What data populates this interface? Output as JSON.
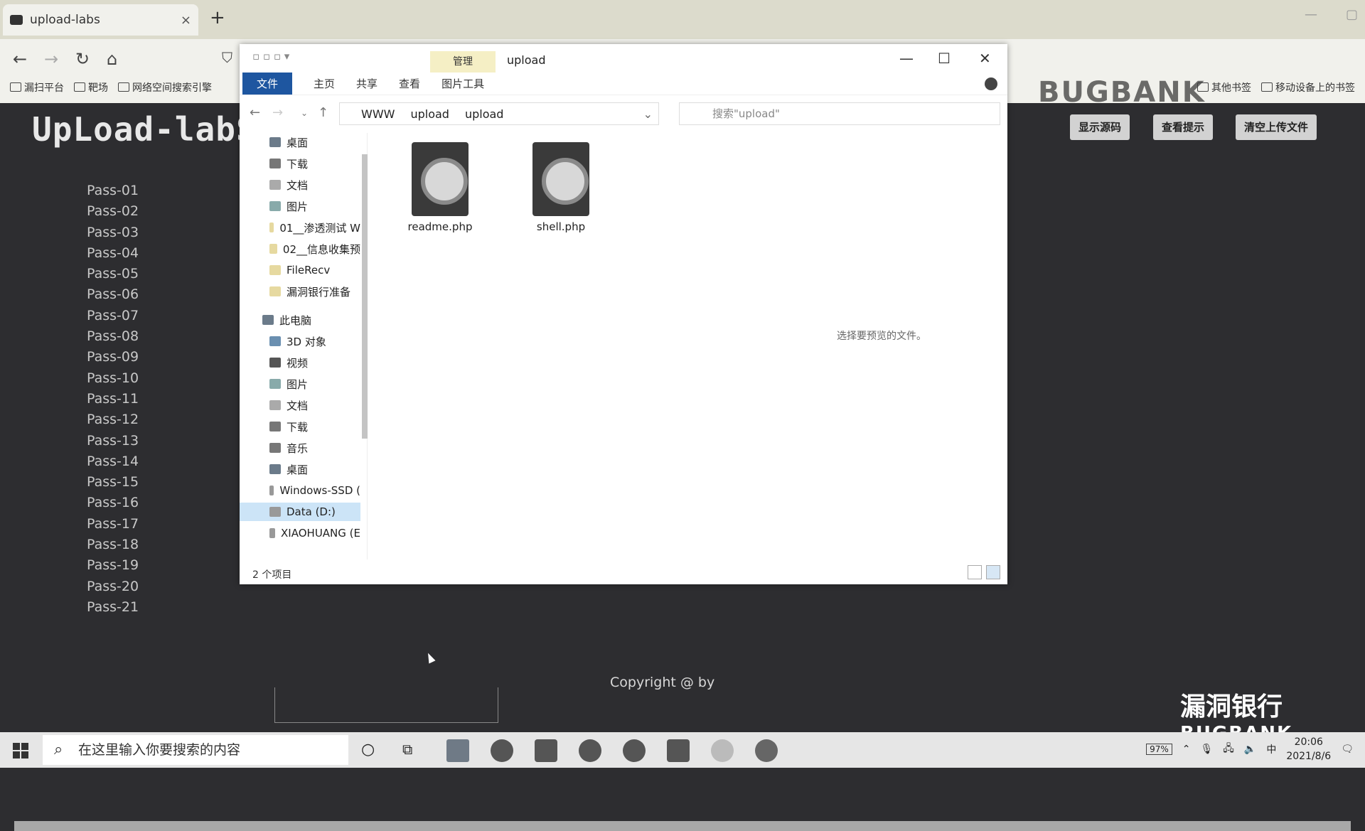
{
  "browser": {
    "tab_title": "upload-labs",
    "tab_close": "×",
    "new_tab": "+",
    "bookmarks": [
      "漏扫平台",
      "靶场",
      "网络空间搜索引擎"
    ],
    "bookmarks_right": [
      "其他书签",
      "移动设备上的书签"
    ],
    "watermark": "BUGBANK"
  },
  "page": {
    "logo": "UpLoad-labS",
    "buttons": [
      "显示源码",
      "查看提示",
      "清空上传文件"
    ],
    "pass_list": [
      "Pass-01",
      "Pass-02",
      "Pass-03",
      "Pass-04",
      "Pass-05",
      "Pass-06",
      "Pass-07",
      "Pass-08",
      "Pass-09",
      "Pass-10",
      "Pass-11",
      "Pass-12",
      "Pass-13",
      "Pass-14",
      "Pass-15",
      "Pass-16",
      "Pass-17",
      "Pass-18",
      "Pass-19",
      "Pass-20",
      "Pass-21"
    ],
    "copyright": "Copyright @  by"
  },
  "explorer": {
    "contextual_tab": "管理",
    "window_title": "upload",
    "ribbon": [
      "文件",
      "主页",
      "共享",
      "查看",
      "图片工具"
    ],
    "breadcrumb": [
      "WWW",
      "upload",
      "upload"
    ],
    "search_placeholder": "搜索\"upload\"",
    "nav_items": [
      {
        "label": "桌面"
      },
      {
        "label": "下载"
      },
      {
        "label": "文档"
      },
      {
        "label": "图片"
      },
      {
        "label": "01__渗透测试 W"
      },
      {
        "label": "02__信息收集预"
      },
      {
        "label": "FileRecv"
      },
      {
        "label": "漏洞银行准备"
      },
      {
        "label": "此电脑"
      },
      {
        "label": "3D 对象"
      },
      {
        "label": "视频"
      },
      {
        "label": "图片"
      },
      {
        "label": "文档"
      },
      {
        "label": "下载"
      },
      {
        "label": "音乐"
      },
      {
        "label": "桌面"
      },
      {
        "label": "Windows-SSD ("
      },
      {
        "label": "Data (D:)",
        "selected": true
      },
      {
        "label": "XIAOHUANG (E"
      }
    ],
    "files": [
      {
        "name": "readme.php",
        "icon": "php-file-icon"
      },
      {
        "name": "shell.php",
        "icon": "php-file-icon"
      }
    ],
    "preview_hint": "选择要预览的文件。",
    "status": "2 个项目"
  },
  "taskbar": {
    "search_placeholder": "在这里输入你要搜索的内容",
    "battery": "97%",
    "ime": "中",
    "time": "20:06",
    "date": "2021/8/6"
  },
  "corner_logo": {
    "cn": "漏洞银行",
    "en": "BUGBANK"
  },
  "colors": {
    "accent": "#1e56a0",
    "page_bg": "#2d2d30"
  }
}
